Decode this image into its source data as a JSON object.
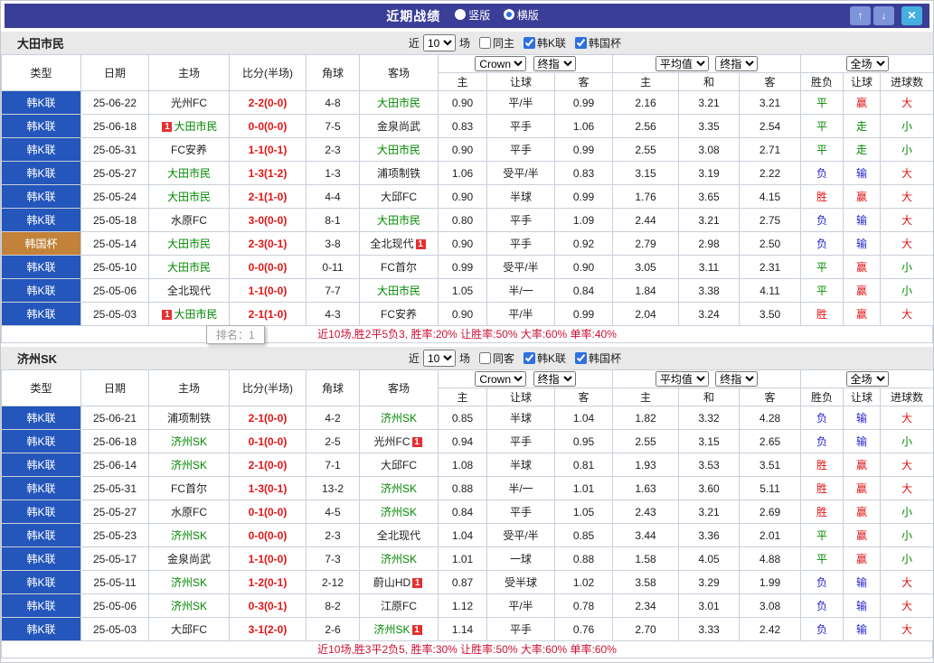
{
  "titlebar": {
    "title": "近期战绩",
    "radios": [
      {
        "label": "竖版",
        "selected": false
      },
      {
        "label": "横版",
        "selected": true
      }
    ],
    "buttons": {
      "up": "↑",
      "down": "↓",
      "close": "✕"
    }
  },
  "filter": {
    "near": "近",
    "round": "10",
    "games": "场",
    "leagues": [
      "韩K联",
      "韩国杯"
    ]
  },
  "table_header": {
    "type": "类型",
    "date": "日期",
    "home": "主场",
    "score": "比分(半场)",
    "corner": "角球",
    "away": "客场",
    "asia_cols": [
      "主",
      "让球",
      "客"
    ],
    "euro_cols": [
      "主",
      "和",
      "客"
    ],
    "result_cols": [
      "胜负",
      "让球",
      "进球数"
    ],
    "selects": {
      "company": "Crown",
      "final1": "终指",
      "average": "平均值",
      "final2": "终指",
      "fullmatch": "全场"
    }
  },
  "tooltip": "排名：1",
  "colors": {
    "titlebar": "#3a3e96",
    "league_blue": "#2456bb",
    "cup_orange": "#c2823a",
    "win_red": "#e01515",
    "draw_green": "#008800",
    "lose_blue": "#2424cc",
    "summary_red": "#cc1133"
  },
  "sections": [
    {
      "team": "大田市民",
      "same": "同主",
      "checks": {
        "same": false,
        "league": true,
        "cup": true
      },
      "summary": "近10场,胜2平5负3, 胜率:20% 让胜率:50% 大率:60% 单率:40%",
      "rows": [
        {
          "type": "韩K联",
          "date": "25-06-22",
          "home": "光州FC",
          "away": "大田市民",
          "away_self": true,
          "score": "2-2(0-0)",
          "corner": "4-8",
          "asia": [
            "0.90",
            "平/半",
            "0.99"
          ],
          "euro": [
            "2.16",
            "3.21",
            "3.21"
          ],
          "res": [
            "平",
            "赢",
            "大"
          ]
        },
        {
          "type": "韩K联",
          "date": "25-06-18",
          "home": "大田市民",
          "home_self": true,
          "home_badge": "1",
          "away": "金泉尚武",
          "score": "0-0(0-0)",
          "corner": "7-5",
          "asia": [
            "0.83",
            "平手",
            "1.06"
          ],
          "euro": [
            "2.56",
            "3.35",
            "2.54"
          ],
          "res": [
            "平",
            "走",
            "小"
          ]
        },
        {
          "type": "韩K联",
          "date": "25-05-31",
          "home": "FC安养",
          "away": "大田市民",
          "away_self": true,
          "score": "1-1(0-1)",
          "corner": "2-3",
          "asia": [
            "0.90",
            "平手",
            "0.99"
          ],
          "euro": [
            "2.55",
            "3.08",
            "2.71"
          ],
          "res": [
            "平",
            "走",
            "小"
          ]
        },
        {
          "type": "韩K联",
          "date": "25-05-27",
          "home": "大田市民",
          "home_self": true,
          "away": "浦项制铁",
          "score": "1-3(1-2)",
          "corner": "1-3",
          "asia": [
            "1.06",
            "受平/半",
            "0.83"
          ],
          "euro": [
            "3.15",
            "3.19",
            "2.22"
          ],
          "res": [
            "负",
            "输",
            "大"
          ]
        },
        {
          "type": "韩K联",
          "date": "25-05-24",
          "home": "大田市民",
          "home_self": true,
          "away": "大邱FC",
          "score": "2-1(1-0)",
          "corner": "4-4",
          "asia": [
            "0.90",
            "半球",
            "0.99"
          ],
          "euro": [
            "1.76",
            "3.65",
            "4.15"
          ],
          "res": [
            "胜",
            "赢",
            "大"
          ]
        },
        {
          "type": "韩K联",
          "date": "25-05-18",
          "home": "水原FC",
          "away": "大田市民",
          "away_self": true,
          "score": "3-0(0-0)",
          "corner": "8-1",
          "asia": [
            "0.80",
            "平手",
            "1.09"
          ],
          "euro": [
            "2.44",
            "3.21",
            "2.75"
          ],
          "res": [
            "负",
            "输",
            "大"
          ]
        },
        {
          "type": "韩国杯",
          "cup": true,
          "date": "25-05-14",
          "home": "大田市民",
          "home_self": true,
          "away": "全北现代",
          "away_badge": "1",
          "score": "2-3(0-1)",
          "corner": "3-8",
          "asia": [
            "0.90",
            "平手",
            "0.92"
          ],
          "euro": [
            "2.79",
            "2.98",
            "2.50"
          ],
          "res": [
            "负",
            "输",
            "大"
          ]
        },
        {
          "type": "韩K联",
          "date": "25-05-10",
          "home": "大田市民",
          "home_self": true,
          "away": "FC首尔",
          "score": "0-0(0-0)",
          "corner": "0-11",
          "asia": [
            "0.99",
            "受平/半",
            "0.90"
          ],
          "euro": [
            "3.05",
            "3.11",
            "2.31"
          ],
          "res": [
            "平",
            "赢",
            "小"
          ]
        },
        {
          "type": "韩K联",
          "date": "25-05-06",
          "home": "全北现代",
          "away": "大田市民",
          "away_self": true,
          "score": "1-1(0-0)",
          "corner": "7-7",
          "asia": [
            "1.05",
            "半/一",
            "0.84"
          ],
          "euro": [
            "1.84",
            "3.38",
            "4.11"
          ],
          "res": [
            "平",
            "赢",
            "小"
          ]
        },
        {
          "type": "韩K联",
          "date": "25-05-03",
          "home": "大田市民",
          "home_self": true,
          "home_badge": "1",
          "away": "FC安养",
          "score": "2-1(1-0)",
          "corner": "4-3",
          "asia": [
            "0.90",
            "平/半",
            "0.99"
          ],
          "euro": [
            "2.04",
            "3.24",
            "3.50"
          ],
          "res": [
            "胜",
            "赢",
            "大"
          ]
        }
      ]
    },
    {
      "team": "济州SK",
      "same": "同客",
      "checks": {
        "same": false,
        "league": true,
        "cup": true
      },
      "summary": "近10场,胜3平2负5, 胜率:30% 让胜率:50% 大率:60% 单率:60%",
      "rows": [
        {
          "type": "韩K联",
          "date": "25-06-21",
          "home": "浦项制铁",
          "away": "济州SK",
          "away_self": true,
          "score": "2-1(0-0)",
          "corner": "4-2",
          "asia": [
            "0.85",
            "半球",
            "1.04"
          ],
          "euro": [
            "1.82",
            "3.32",
            "4.28"
          ],
          "res": [
            "负",
            "输",
            "大"
          ]
        },
        {
          "type": "韩K联",
          "date": "25-06-18",
          "home": "济州SK",
          "home_self": true,
          "away": "光州FC",
          "away_badge": "1",
          "score": "0-1(0-0)",
          "corner": "2-5",
          "asia": [
            "0.94",
            "平手",
            "0.95"
          ],
          "euro": [
            "2.55",
            "3.15",
            "2.65"
          ],
          "res": [
            "负",
            "输",
            "小"
          ]
        },
        {
          "type": "韩K联",
          "date": "25-06-14",
          "home": "济州SK",
          "home_self": true,
          "away": "大邱FC",
          "score": "2-1(0-0)",
          "corner": "7-1",
          "asia": [
            "1.08",
            "半球",
            "0.81"
          ],
          "euro": [
            "1.93",
            "3.53",
            "3.51"
          ],
          "res": [
            "胜",
            "赢",
            "大"
          ]
        },
        {
          "type": "韩K联",
          "date": "25-05-31",
          "home": "FC首尔",
          "away": "济州SK",
          "away_self": true,
          "score": "1-3(0-1)",
          "corner": "13-2",
          "asia": [
            "0.88",
            "半/一",
            "1.01"
          ],
          "euro": [
            "1.63",
            "3.60",
            "5.11"
          ],
          "res": [
            "胜",
            "赢",
            "大"
          ]
        },
        {
          "type": "韩K联",
          "date": "25-05-27",
          "home": "水原FC",
          "away": "济州SK",
          "away_self": true,
          "score": "0-1(0-0)",
          "corner": "4-5",
          "asia": [
            "0.84",
            "平手",
            "1.05"
          ],
          "euro": [
            "2.43",
            "3.21",
            "2.69"
          ],
          "res": [
            "胜",
            "赢",
            "小"
          ]
        },
        {
          "type": "韩K联",
          "date": "25-05-23",
          "home": "济州SK",
          "home_self": true,
          "away": "全北现代",
          "score": "0-0(0-0)",
          "corner": "2-3",
          "asia": [
            "1.04",
            "受平/半",
            "0.85"
          ],
          "euro": [
            "3.44",
            "3.36",
            "2.01"
          ],
          "res": [
            "平",
            "赢",
            "小"
          ]
        },
        {
          "type": "韩K联",
          "date": "25-05-17",
          "home": "金泉尚武",
          "away": "济州SK",
          "away_self": true,
          "score": "1-1(0-0)",
          "corner": "7-3",
          "asia": [
            "1.01",
            "一球",
            "0.88"
          ],
          "euro": [
            "1.58",
            "4.05",
            "4.88"
          ],
          "res": [
            "平",
            "赢",
            "小"
          ]
        },
        {
          "type": "韩K联",
          "date": "25-05-11",
          "home": "济州SK",
          "home_self": true,
          "away": "蔚山HD",
          "away_badge": "1",
          "score": "1-2(0-1)",
          "corner": "2-12",
          "asia": [
            "0.87",
            "受半球",
            "1.02"
          ],
          "euro": [
            "3.58",
            "3.29",
            "1.99"
          ],
          "res": [
            "负",
            "输",
            "大"
          ]
        },
        {
          "type": "韩K联",
          "date": "25-05-06",
          "home": "济州SK",
          "home_self": true,
          "away": "江原FC",
          "score": "0-3(0-1)",
          "corner": "8-2",
          "asia": [
            "1.12",
            "平/半",
            "0.78"
          ],
          "euro": [
            "2.34",
            "3.01",
            "3.08"
          ],
          "res": [
            "负",
            "输",
            "大"
          ]
        },
        {
          "type": "韩K联",
          "date": "25-05-03",
          "home": "大邱FC",
          "away": "济州SK",
          "away_self": true,
          "away_badge": "1",
          "score": "3-1(2-0)",
          "corner": "2-6",
          "asia": [
            "1.14",
            "平手",
            "0.76"
          ],
          "euro": [
            "2.70",
            "3.33",
            "2.42"
          ],
          "res": [
            "负",
            "输",
            "大"
          ]
        }
      ]
    }
  ]
}
